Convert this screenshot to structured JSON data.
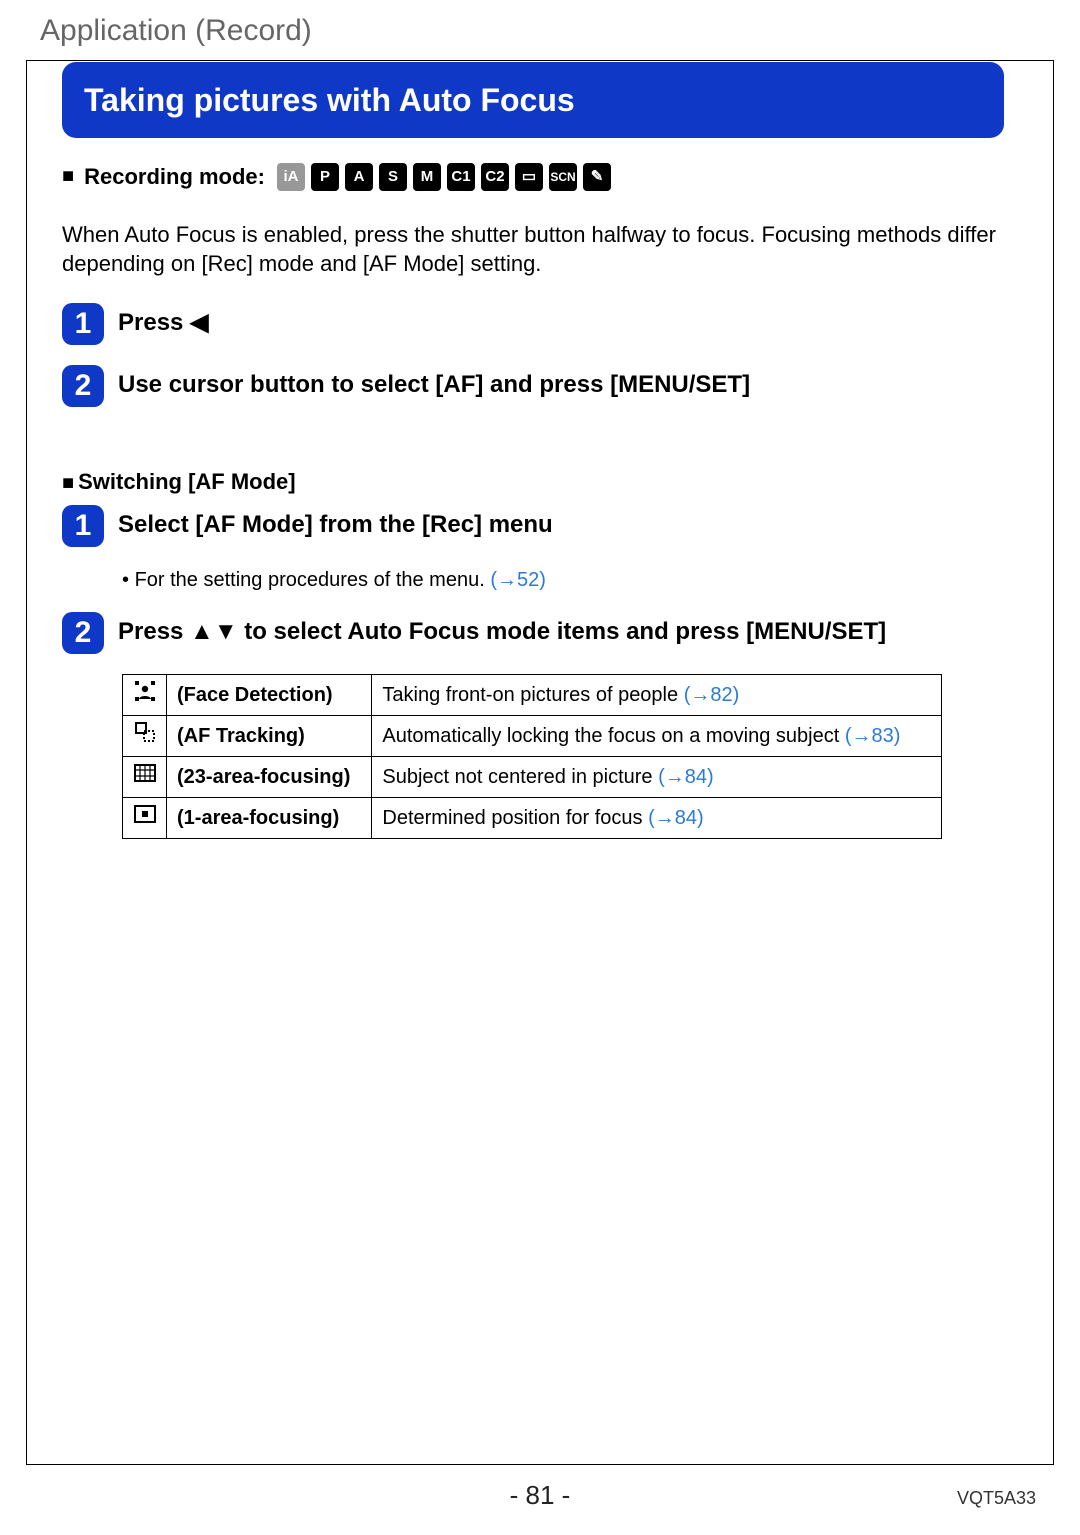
{
  "header": {
    "category": "Application (Record)"
  },
  "title": "Taking pictures with Auto Focus",
  "recording_mode_label": "Recording mode:",
  "mode_icons": [
    "iA",
    "P",
    "A",
    "S",
    "M",
    "C1",
    "C2",
    "▭",
    "SCN",
    "✎"
  ],
  "intro": "When Auto Focus is enabled, press the shutter button halfway to focus. Focusing methods differ depending on [Rec] mode and [AF Mode] setting.",
  "steps_main": {
    "s1": "Press ◀",
    "s2": "Use cursor button to select [AF] and press [MENU/SET]"
  },
  "switching_heading": "Switching [AF Mode]",
  "steps_switch": {
    "s1": "Select [AF Mode] from the [Rec] menu",
    "s1_sub_text": "For the setting procedures of the menu. ",
    "s1_sub_link": "(→52)",
    "s2": "Press ▲▼ to select Auto Focus mode items and press [MENU/SET]"
  },
  "table": {
    "rows": [
      {
        "name": "(Face Detection)",
        "desc": "Taking front-on pictures of people ",
        "link": "(→82)"
      },
      {
        "name": "(AF Tracking)",
        "desc": "Automatically locking the focus on a moving subject ",
        "link": "(→83)"
      },
      {
        "name": "(23-area-focusing)",
        "desc": "Subject not centered in picture ",
        "link": "(→84)"
      },
      {
        "name": "(1-area-focusing)",
        "desc": "Determined position for focus ",
        "link": "(→84)"
      }
    ]
  },
  "footer": {
    "page": "- 81 -",
    "code": "VQT5A33"
  }
}
